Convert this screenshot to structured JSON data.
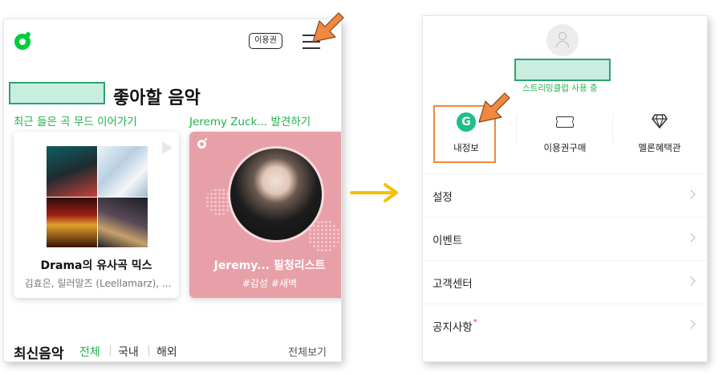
{
  "left_screen": {
    "ticket_button_label": "이용권",
    "greeting": "좋아할 음악",
    "section1_label": "최근 들은 곡 무드 이어가기",
    "section2_label": "Jeremy Zuck... 발견하기",
    "card1": {
      "title": "Drama의 유사곡 믹스",
      "subtitle": "김효은, 릴러말즈 (Leellamarz), ..."
    },
    "card2": {
      "title": "Jeremy... 필청리스트",
      "subtitle": "#감성 #새벽"
    },
    "latest": {
      "title": "최신음악",
      "tabs": [
        "전체",
        "국내",
        "해외"
      ],
      "see_all": "전체보기"
    }
  },
  "right_screen": {
    "membership_status": "스트리밍클럽 사용 중",
    "quick_menu": [
      {
        "label": "내정보",
        "icon": "g-profile-icon",
        "letter": "G"
      },
      {
        "label": "이용권구매",
        "icon": "ticket-icon"
      },
      {
        "label": "멜론혜택관",
        "icon": "diamond-icon"
      }
    ],
    "menu_items": [
      {
        "label": "설정"
      },
      {
        "label": "이벤트"
      },
      {
        "label": "고객센터"
      },
      {
        "label": "공지사항",
        "badge": "*"
      }
    ]
  },
  "colors": {
    "brand_green": "#00cd3c",
    "highlight_orange": "#f0883d",
    "arrow_yellow": "#f5c000",
    "redaction_fill": "#c8eee0"
  }
}
